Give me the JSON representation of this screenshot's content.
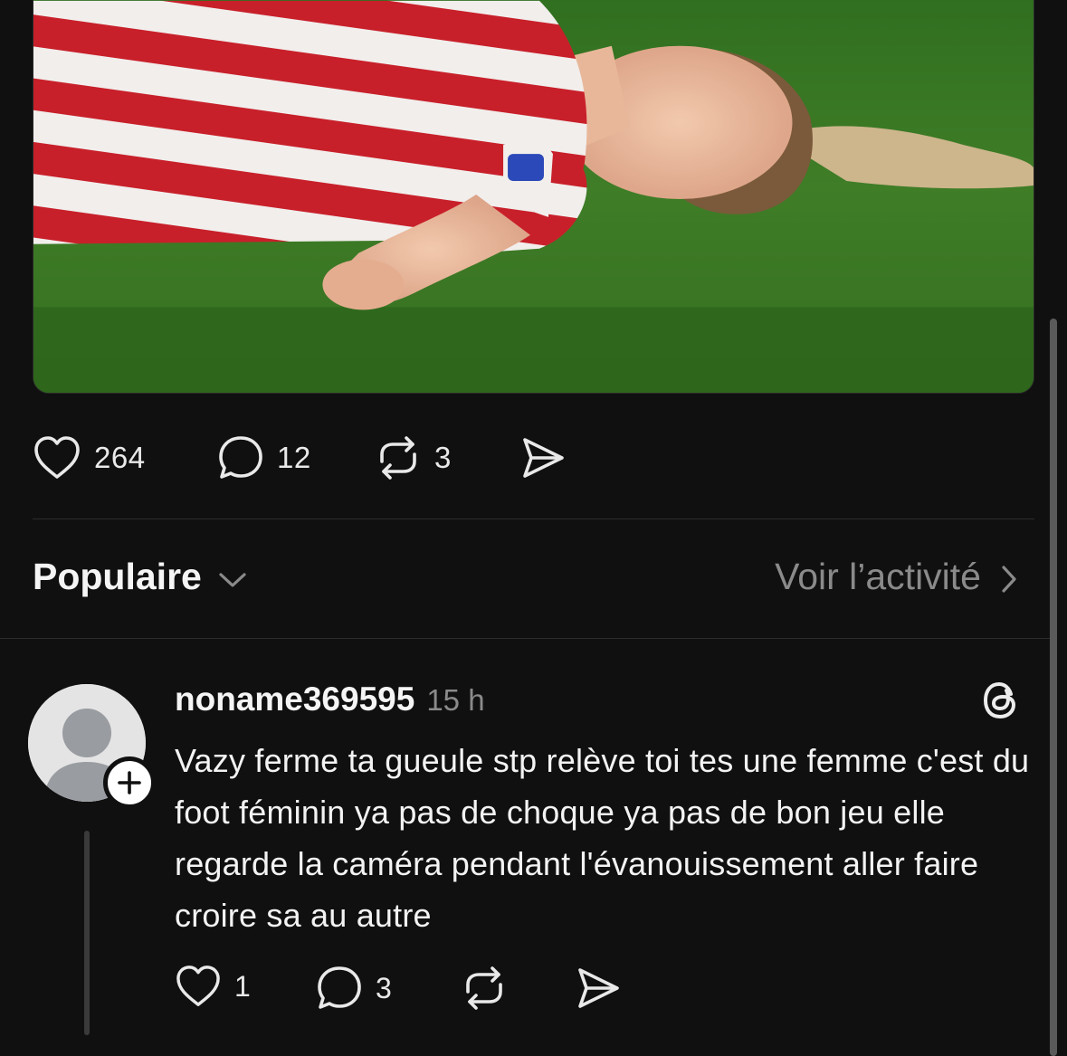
{
  "post": {
    "image_alt": "",
    "actions": {
      "likes": "264",
      "replies": "12",
      "reposts": "3"
    }
  },
  "sort": {
    "title": "Populaire",
    "activity_link": "Voir l’activité"
  },
  "comment": {
    "username": "noname369595",
    "time": "15 h",
    "text": "Vazy ferme ta gueule stp relève toi tes une femme c'est du foot féminin ya pas de choque ya pas de bon jeu elle regarde la caméra pendant l'évanouissement aller faire croire sa au autre",
    "likes": "1",
    "replies": "3"
  },
  "icons": {
    "like": "heart-icon",
    "reply": "speech-bubble-icon",
    "repost": "repost-arrows-icon",
    "share": "send-arrow-icon",
    "sort_chevron": "chevron-down-icon",
    "activity_chevron": "chevron-right-icon",
    "threads": "threads-logo-icon",
    "follow": "plus-icon"
  },
  "colors": {
    "background": "#101010",
    "text": "#f3f3f3",
    "secondary_text": "#8a8a8a",
    "divider": "#2c2c2c"
  }
}
